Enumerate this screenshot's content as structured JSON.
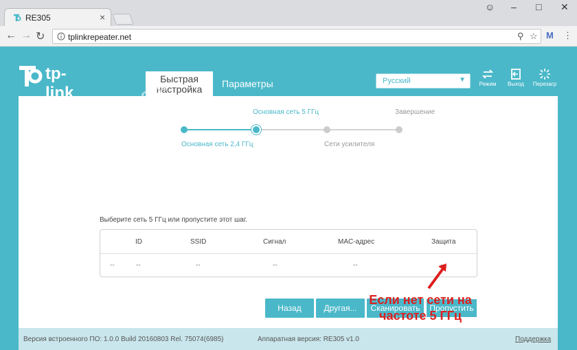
{
  "browser": {
    "tab_title": "RE305",
    "tab_close": "×",
    "window_controls": {
      "profile": "☺",
      "minimize": "–",
      "maximize": "□",
      "close": "✕"
    },
    "url": "tplinkrepeater.net",
    "icons": [
      "back-icon",
      "forward-icon",
      "reload-icon",
      "lock-icon",
      "key-icon",
      "star-icon",
      "gmail-icon",
      "menu-icon"
    ]
  },
  "header": {
    "logo_text": "tp-link",
    "tabs": [
      {
        "label_line1": "Быстрая",
        "label_line2": "настройка"
      },
      {
        "label": "Параметры"
      }
    ],
    "language": "Русский",
    "buttons": [
      {
        "label": "Режим",
        "icon": "mode-icon"
      },
      {
        "label": "Выход",
        "icon": "logout-icon"
      },
      {
        "label": "Перезагр",
        "icon": "reboot-icon"
      }
    ]
  },
  "watermark": "help-wifi.com",
  "wizard": {
    "steps_top": [
      "Основная сеть 5 ГГц",
      "Завершение"
    ],
    "steps_bottom": [
      "Основная сеть 2,4 ГГц",
      "Сети усилителя"
    ],
    "prompt": "Выберите сеть 5 ГГц или пропустите этот шаг.",
    "table": {
      "headers": [
        "ID",
        "SSID",
        "Сигнал",
        "MAC-адрес",
        "Защита"
      ],
      "row": [
        "--",
        "--",
        "--",
        "--",
        "--",
        "--"
      ]
    },
    "buttons": [
      "Назад",
      "Другая...",
      "Сканировать",
      "Пропустить"
    ]
  },
  "annotation": {
    "line1": "Если нет сети на",
    "line2": "частоте 5 ГГц"
  },
  "footer": {
    "firmware": "Версия встроенного ПО: 1.0.0 Build 20160803 Rel. 75074(6985)",
    "hardware": "Аппаратная версия: RE305 v1.0",
    "support": "Поддержка"
  },
  "colors": {
    "accent": "#4ab8c9",
    "annotation": "#dd1f1f",
    "inactive_step": "#cccccc"
  }
}
